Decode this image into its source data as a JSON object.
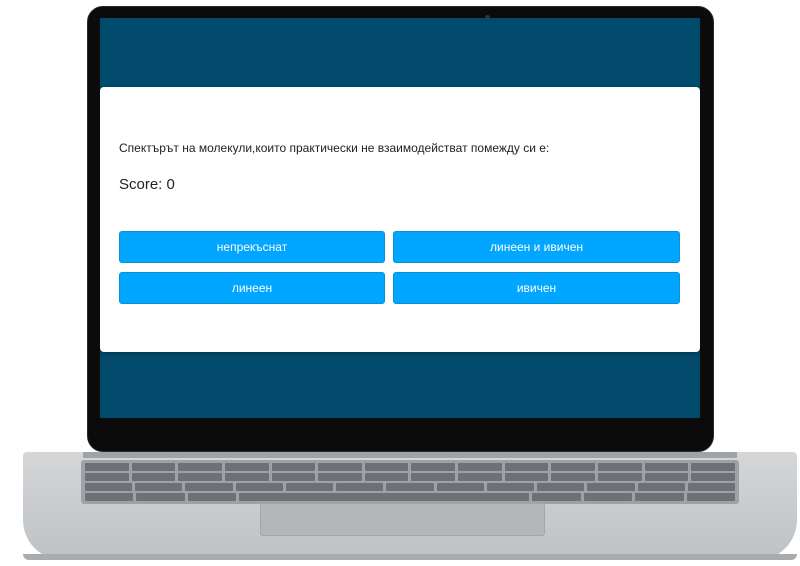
{
  "quiz": {
    "question": "Спектърът на молекули,които практически не взаимодействат помежду си е:",
    "score_label": "Score: 0",
    "answers": [
      "непрекъснат",
      "линеен и ивичен",
      "линеен",
      "ивичен"
    ]
  },
  "colors": {
    "screen_background": "#024a6b",
    "card_background": "#ffffff",
    "answer_button": "#00a6ff",
    "answer_text": "#ffffff"
  }
}
